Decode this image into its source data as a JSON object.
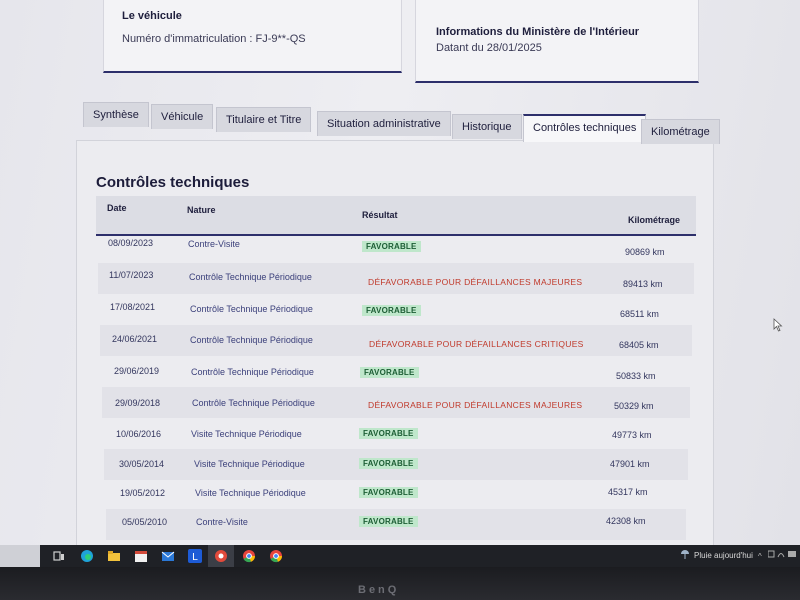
{
  "vehicle_card": {
    "title": "Le véhicule",
    "registration": "Numéro d'immatriculation : FJ-9**-QS"
  },
  "ministry_card": {
    "title": "Informations du Ministère de l'Intérieur",
    "date": "Datant du 28/01/2025"
  },
  "tabs": [
    {
      "label": "Synthèse",
      "active": false
    },
    {
      "label": "Véhicule",
      "active": false
    },
    {
      "label": "Titulaire et Titre",
      "active": false
    },
    {
      "label": "Situation administrative",
      "active": false
    },
    {
      "label": "Historique",
      "active": false
    },
    {
      "label": "Contrôles techniques",
      "active": true
    },
    {
      "label": "Kilométrage",
      "active": false
    }
  ],
  "section": {
    "title": "Contrôles techniques",
    "columns": {
      "date": "Date",
      "nature": "Nature",
      "result": "Résultat",
      "mileage": "Kilométrage"
    },
    "rows": [
      {
        "date": "08/09/2023",
        "nature": "Contre-Visite",
        "result": "FAVORABLE",
        "km": "90869 km"
      },
      {
        "date": "11/07/2023",
        "nature": "Contrôle Technique Périodique",
        "result": "DÉFAVORABLE POUR DÉFAILLANCES MAJEURES",
        "km": "89413 km"
      },
      {
        "date": "17/08/2021",
        "nature": "Contrôle Technique Périodique",
        "result": "FAVORABLE",
        "km": "68511 km"
      },
      {
        "date": "24/06/2021",
        "nature": "Contrôle Technique Périodique",
        "result": "DÉFAVORABLE POUR DÉFAILLANCES CRITIQUES",
        "km": "68405 km"
      },
      {
        "date": "29/06/2019",
        "nature": "Contrôle Technique Périodique",
        "result": "FAVORABLE",
        "km": "50833 km"
      },
      {
        "date": "29/09/2018",
        "nature": "Contrôle Technique Périodique",
        "result": "DÉFAVORABLE POUR DÉFAILLANCES MAJEURES",
        "km": "50329 km"
      },
      {
        "date": "10/06/2016",
        "nature": "Visite Technique Périodique",
        "result": "FAVORABLE",
        "km": "49773 km"
      },
      {
        "date": "30/05/2014",
        "nature": "Visite Technique Périodique",
        "result": "FAVORABLE",
        "km": "47901 km"
      },
      {
        "date": "19/05/2012",
        "nature": "Visite Technique Périodique",
        "result": "FAVORABLE",
        "km": "45317 km"
      },
      {
        "date": "05/05/2010",
        "nature": "Contre-Visite",
        "result": "FAVORABLE",
        "km": "42308 km"
      }
    ]
  },
  "taskbar": {
    "weather": "Pluie aujourd'hui",
    "icons": [
      "task-view-icon",
      "edge-icon",
      "file-explorer-icon",
      "calendar-icon",
      "mail-icon",
      "l-app-icon",
      "chrome-red-icon",
      "chrome-icon",
      "chrome-icon-2"
    ]
  },
  "monitor": {
    "brand": "BenQ"
  },
  "colors": {
    "accent": "#2d2f6b",
    "favorable_bg": "#bfe7cb",
    "favorable_text": "#1d5e35",
    "unfavorable_text": "#c0392b"
  }
}
